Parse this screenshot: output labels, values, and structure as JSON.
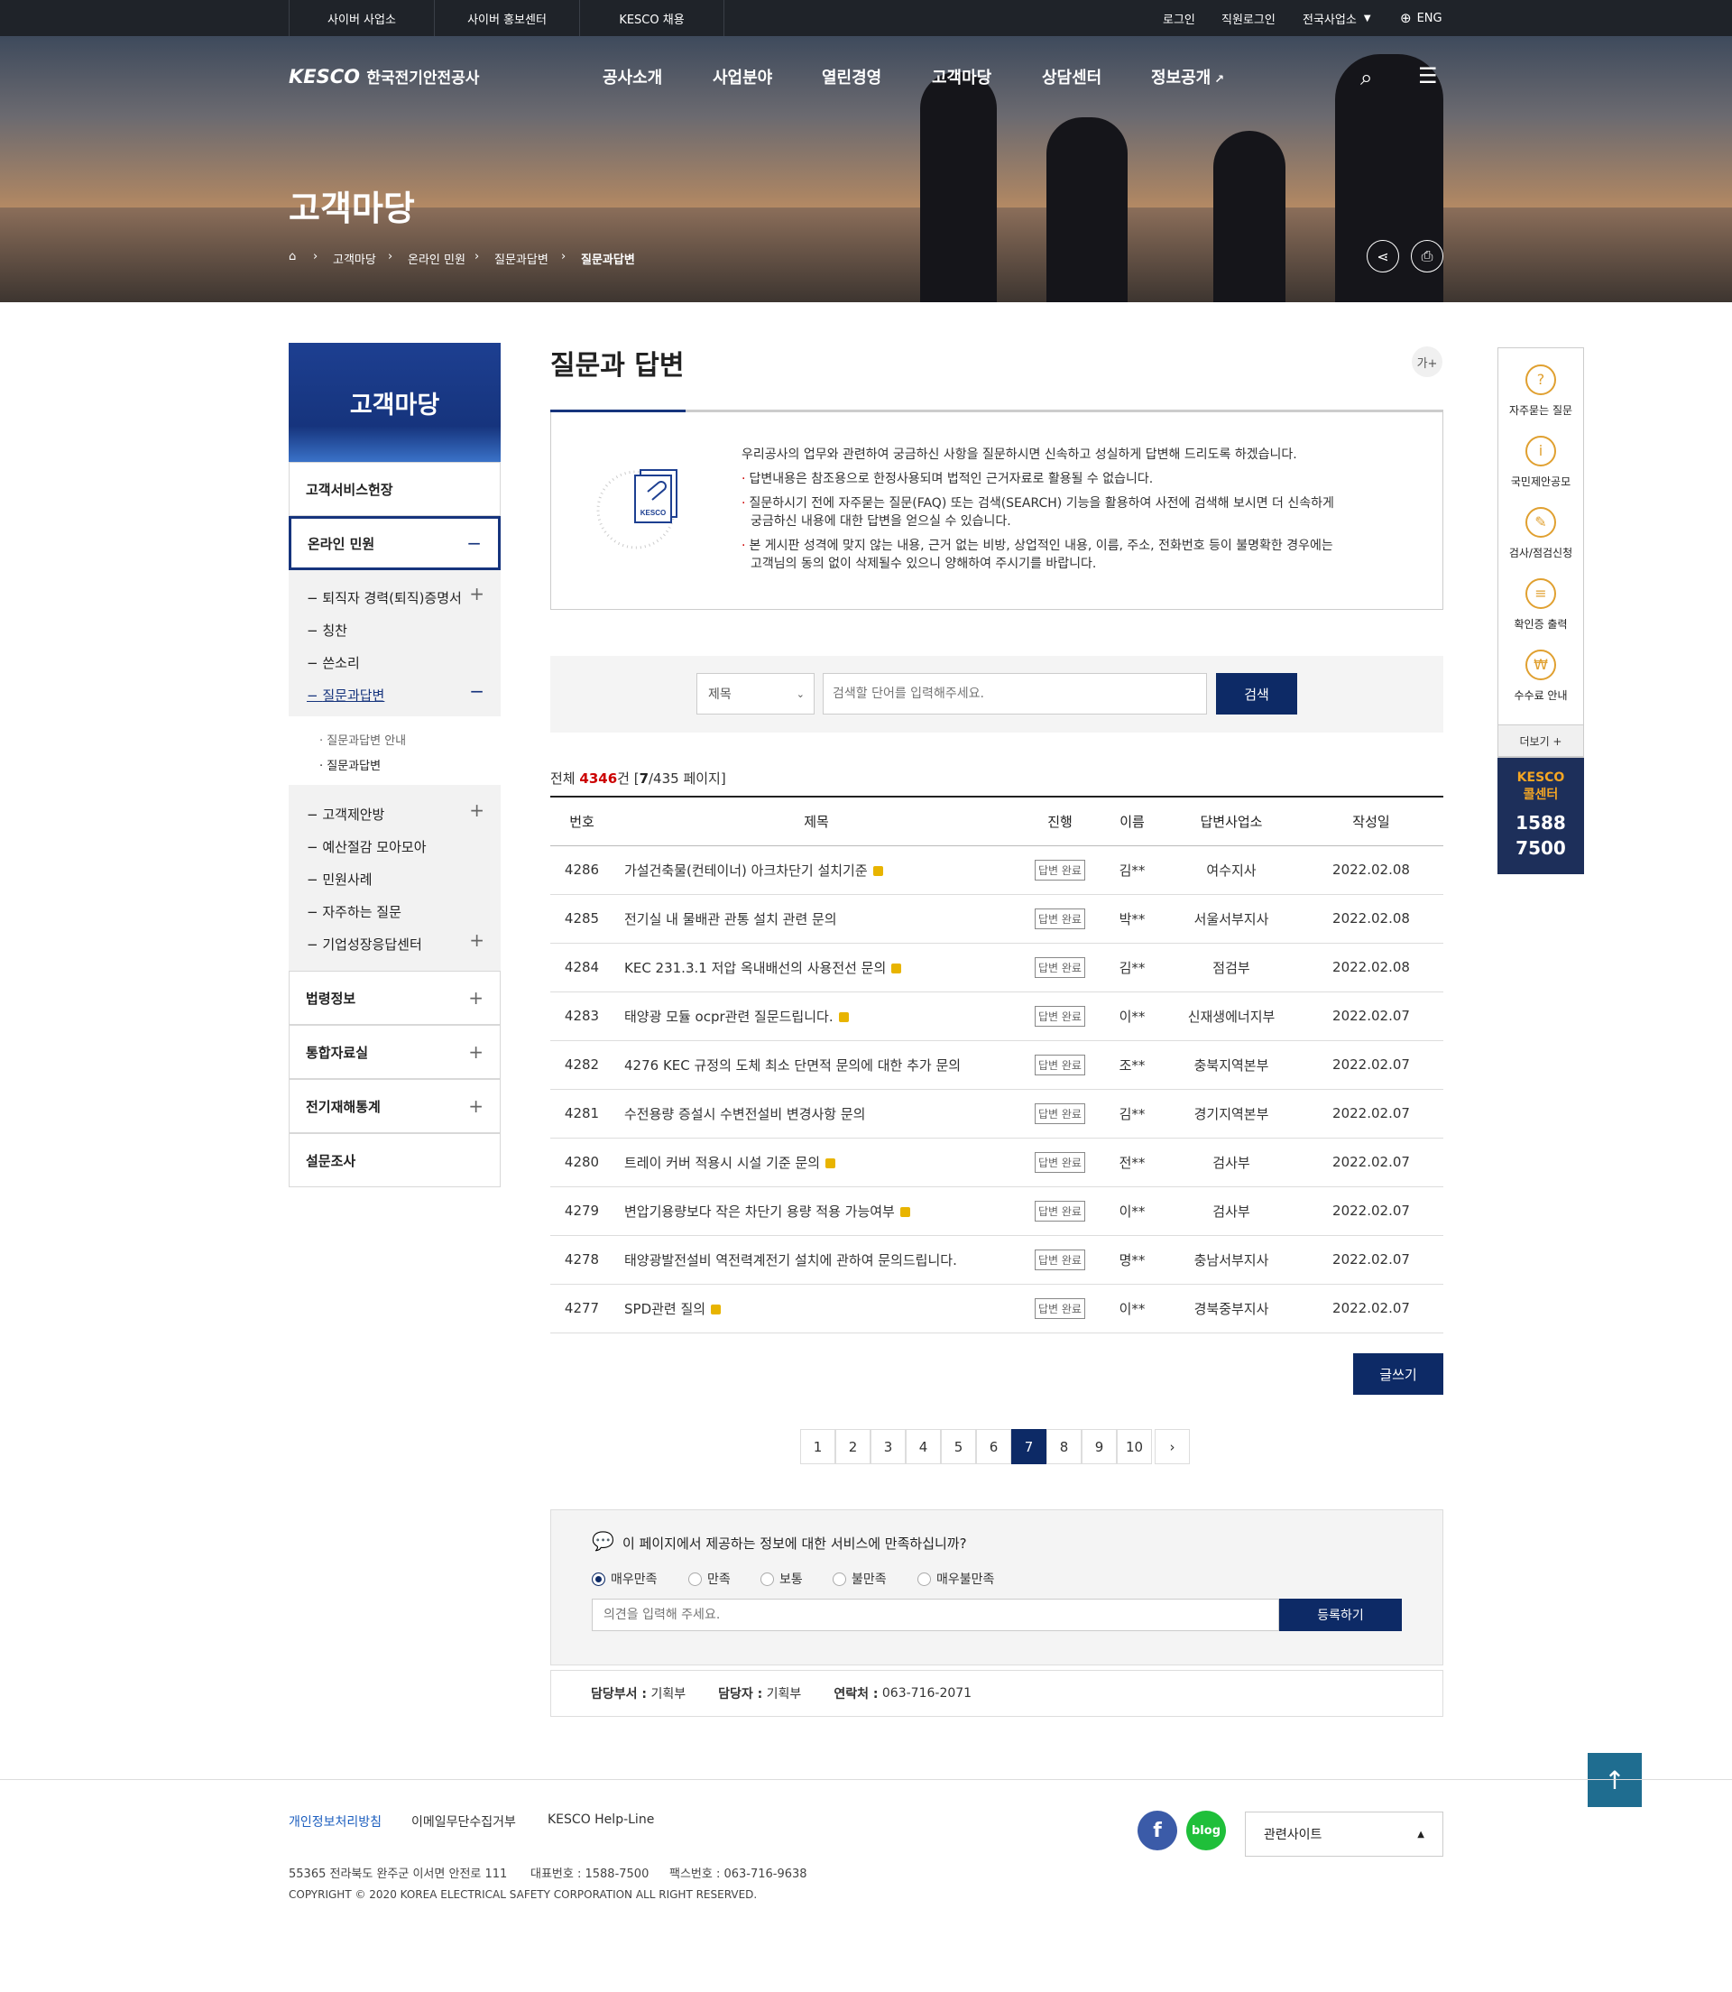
{
  "util": {
    "tabs": [
      "사이버 사업소",
      "사이버 홍보센터",
      "KESCO 채용"
    ],
    "login": "로그인",
    "staff_login": "직원로그인",
    "offices": "전국사업소",
    "lang": "ENG"
  },
  "header": {
    "logo": "KESCO",
    "logo_sub": "한국전기안전공사",
    "nav": [
      "공사소개",
      "사업분야",
      "열린경영",
      "고객마당",
      "상담센터",
      "정보공개"
    ]
  },
  "hero": {
    "title": "고객마당",
    "breadcrumb": [
      "고객마당",
      "온라인 민원",
      "질문과답변",
      "질문과답변"
    ]
  },
  "sidebar": {
    "title": "고객마당",
    "menu1": "고객서비스헌장",
    "menu2": "온라인 민원",
    "sub": [
      "퇴직자 경력(퇴직)증명서",
      "칭찬",
      "쓴소리",
      "질문과답변"
    ],
    "subsub": [
      "질문과답변 안내",
      "질문과답변"
    ],
    "sub2": [
      "고객제안방",
      "예산절감 모아모아",
      "민원사례",
      "자주하는 질문",
      "기업성장응답센터"
    ],
    "menu3": "법령정보",
    "menu4": "통합자료실",
    "menu5": "전기재해통계",
    "menu6": "설문조사"
  },
  "content": {
    "title": "질문과 답변",
    "font_btn": "가+",
    "guide": [
      "우리공사의 업무와 관련하여 궁금하신 사항을 질문하시면 신속하고 성실하게 답변해 드리도록 하겠습니다.",
      "답변내용은 참조용으로 한정사용되며 법적인 근거자료로 활용될 수 없습니다.",
      "질문하시기 전에 자주묻는 질문(FAQ) 또는 검색(SEARCH) 기능을 활용하여 사전에 검색해 보시면 더 신속하게",
      "궁금하신 내용에 대한 답변을 얻으실 수 있습니다.",
      "본 게시판 성격에 맞지 않는 내용, 근거 없는 비방, 상업적인 내용, 이름, 주소, 전화번호 등이 불명확한 경우에는",
      "고객님의 동의 없이 삭제될수 있으니 양해하여 주시기를 바랍니다."
    ],
    "search": {
      "select": "제목",
      "placeholder": "검색할 단어를 입력해주세요.",
      "button": "검색"
    },
    "count_prefix": "전체",
    "count_total": "4346",
    "count_suffix": "건 [",
    "count_page": "7",
    "count_pages": "/435 페이지]",
    "table": {
      "headers": [
        "번호",
        "제목",
        "진행",
        "이름",
        "답변사업소",
        "작성일"
      ],
      "rows": [
        {
          "no": "4286",
          "title": "가설건축물(컨테이너) 아크차단기 설치기준",
          "lock": true,
          "status": "답변 완료",
          "name": "김**",
          "office": "여수지사",
          "date": "2022.02.08"
        },
        {
          "no": "4285",
          "title": "전기실 내 물배관 관통 설치 관련 문의",
          "lock": false,
          "status": "답변 완료",
          "name": "박**",
          "office": "서울서부지사",
          "date": "2022.02.08"
        },
        {
          "no": "4284",
          "title": "KEC 231.3.1 저압 옥내배선의 사용전선 문의",
          "lock": true,
          "status": "답변 완료",
          "name": "김**",
          "office": "점검부",
          "date": "2022.02.08"
        },
        {
          "no": "4283",
          "title": "태양광 모듈 ocpr관련 질문드립니다.",
          "lock": true,
          "status": "답변 완료",
          "name": "이**",
          "office": "신재생에너지부",
          "date": "2022.02.07"
        },
        {
          "no": "4282",
          "title": "4276 KEC 규정의 도체 최소 단면적 문의에 대한 추가 문의",
          "lock": false,
          "status": "답변 완료",
          "name": "조**",
          "office": "충북지역본부",
          "date": "2022.02.07"
        },
        {
          "no": "4281",
          "title": "수전용량 증설시 수변전설비 변경사항 문의",
          "lock": false,
          "status": "답변 완료",
          "name": "김**",
          "office": "경기지역본부",
          "date": "2022.02.07"
        },
        {
          "no": "4280",
          "title": "트레이 커버 적용시 시설 기준 문의",
          "lock": true,
          "status": "답변 완료",
          "name": "전**",
          "office": "검사부",
          "date": "2022.02.07"
        },
        {
          "no": "4279",
          "title": "변압기용량보다 작은 차단기 용량 적용 가능여부",
          "lock": true,
          "status": "답변 완료",
          "name": "이**",
          "office": "검사부",
          "date": "2022.02.07"
        },
        {
          "no": "4278",
          "title": "태양광발전설비 역전력계전기 설치에 관하여 문의드립니다.",
          "lock": false,
          "status": "답변 완료",
          "name": "명**",
          "office": "충남서부지사",
          "date": "2022.02.07"
        },
        {
          "no": "4277",
          "title": "SPD관련 질의",
          "lock": true,
          "status": "답변 완료",
          "name": "이**",
          "office": "경북중부지사",
          "date": "2022.02.07"
        }
      ]
    },
    "write_button": "글쓰기",
    "pagination": [
      "1",
      "2",
      "3",
      "4",
      "5",
      "6",
      "7",
      "8",
      "9",
      "10"
    ],
    "current_page": "7",
    "next": "›"
  },
  "survey": {
    "question": "이 페이지에서 제공하는 정보에 대한 서비스에 만족하십니까?",
    "options": [
      "매우만족",
      "만족",
      "보통",
      "불만족",
      "매우불만족"
    ],
    "selected": "매우만족",
    "placeholder": "의견을 입력해 주세요.",
    "submit": "등록하기"
  },
  "manager": {
    "dept_label": "담당부서 :",
    "dept": "기획부",
    "person_label": "담당자 :",
    "person": "기획부",
    "contact_label": "연락처 :",
    "contact": "063-716-2071"
  },
  "quick": {
    "items": [
      "자주묻는 질문",
      "국민제안공모",
      "검사/점검신청",
      "확인증 출력",
      "수수료 안내"
    ],
    "more": "더보기 +",
    "call_title1": "KESCO",
    "call_title2": "콜센터",
    "call_num1": "1588",
    "call_num2": "7500"
  },
  "footer": {
    "links": [
      "개인정보처리방침",
      "이메일무단수집거부",
      "KESCO Help-Line"
    ],
    "address": "55365 전라북도 완주군 이서면 안전로 111",
    "tel": "대표번호 : 1588-7500",
    "fax": "팩스번호 : 063-716-9638",
    "copyright": "COPYRIGHT © 2020 KOREA ELECTRICAL SAFETY CORPORATION ALL RIGHT RESERVED.",
    "blog": "blog",
    "related": "관련사이트"
  },
  "colors": {
    "navy": "#0d2a66",
    "accent_red": "#c00000",
    "lnb_blue": "#16347d"
  }
}
